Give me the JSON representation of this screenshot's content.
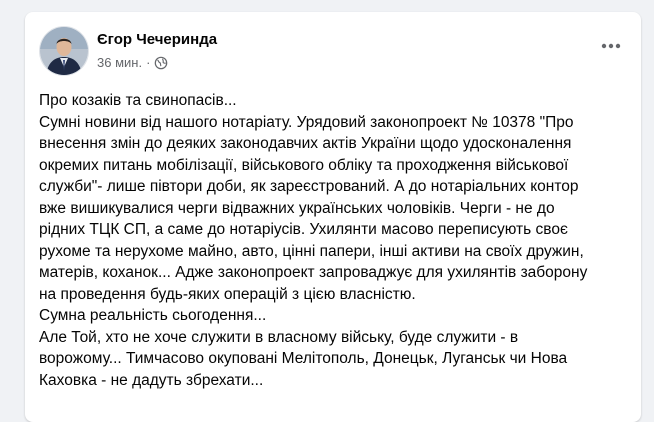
{
  "post": {
    "author": "Єгор Чечеринда",
    "time": "36 мин.",
    "separator": "·",
    "privacy_icon": "globe-icon",
    "more_icon": "more-options-icon",
    "lines": [
      "Про козаків та свинопасів...",
      "Сумні новини від нашого нотаріату. Урядовий законопроект  № 10378 \"Про",
      "внесення змін до деяких законодавчих актів України щодо удосконалення",
      "окремих питань мобілізації, військового обліку та проходження військової",
      "служби\"- лише півтори доби, як зареєстрований. А до нотаріальних контор",
      "вже вишикувалися черги відважних українських чоловіків. Черги - не до",
      "рідних ТЦК СП, а саме до нотаріусів. Ухилянти масово переписують своє",
      "рухоме та нерухоме майно, авто, цінні папери, інші активи  на своїх дружин,",
      "матерів, коханок... Адже законопроект запроваджує для ухилянтів заборону",
      "на проведення будь-яких операцій з цією власністю.",
      "Сумна реальність сьогодення...",
      "Але Той, хто не хоче служити в власному війську, буде служити - в",
      "ворожому... Тимчасово окуповані Мелітополь, Донецьк, Луганськ чи Нова",
      "Каховка - не дадуть збрехати..."
    ]
  },
  "colors": {
    "background": "#f0f2f5",
    "card": "#ffffff",
    "text": "#050505",
    "secondary": "#65676b"
  }
}
